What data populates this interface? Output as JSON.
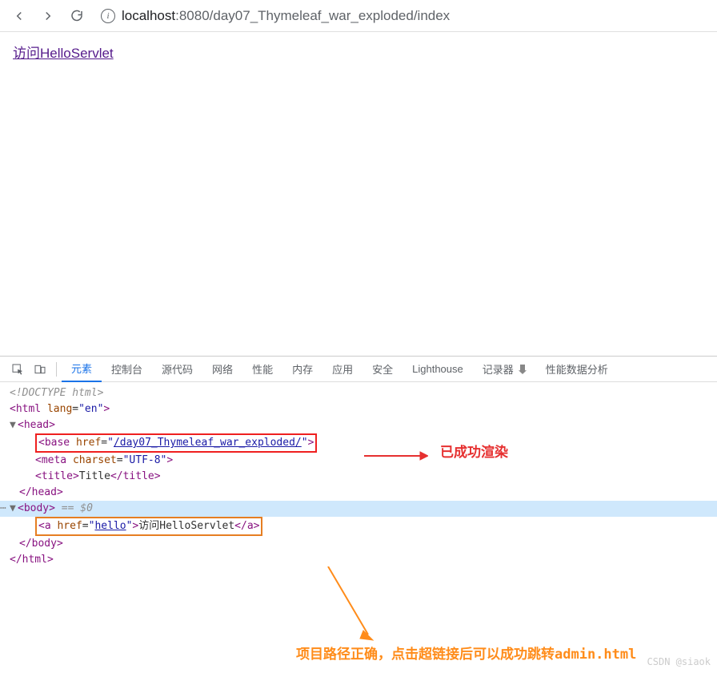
{
  "browser": {
    "url_host": "localhost",
    "url_rest": ":8080/day07_Thymeleaf_war_exploded/index"
  },
  "page": {
    "link_text": "访问HelloServlet"
  },
  "devtools": {
    "tabs": {
      "elements": "元素",
      "console": "控制台",
      "sources": "源代码",
      "network": "网络",
      "performance": "性能",
      "memory": "内存",
      "application": "应用",
      "security": "安全",
      "lighthouse": "Lighthouse",
      "recorder": "记录器",
      "perf_insights": "性能数据分析"
    },
    "code": {
      "doctype": "<!DOCTYPE html>",
      "html_open_1": "<html ",
      "html_lang_attr": "lang",
      "html_lang_val": "\"en\"",
      "html_open_2": ">",
      "head_open": "<head>",
      "base_open": "<base ",
      "base_attr": "href",
      "base_val": "\"",
      "base_link": "/day07_Thymeleaf_war_exploded/",
      "base_val_end": "\"",
      "base_close": ">",
      "meta_open": "<meta ",
      "meta_attr": "charset",
      "meta_val": "\"UTF-8\"",
      "meta_close": ">",
      "title_open": "<title>",
      "title_text": "Title",
      "title_close": "</title>",
      "head_close": "</head>",
      "body_open": "<body>",
      "body_sel": " == $0",
      "a_open": "<a ",
      "a_attr": "href",
      "a_val_q": "\"",
      "a_link": "hello",
      "a_val_end": "\"",
      "a_open_end": ">",
      "a_text": "访问HelloServlet",
      "a_close": "</a>",
      "body_close": "</body>",
      "html_close": "</html>"
    }
  },
  "annotations": {
    "red": "已成功渲染",
    "orange": "项目路径正确，点击超链接后可以成功跳转admin.html"
  },
  "watermark": "CSDN @siaok"
}
